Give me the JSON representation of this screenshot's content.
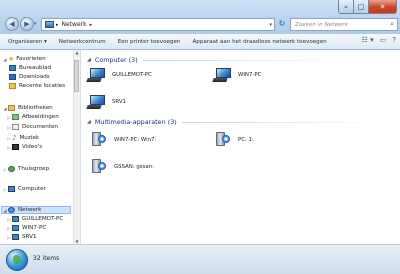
{
  "address": {
    "crumbs": [
      "Netwerk"
    ]
  },
  "search": {
    "placeholder": "Zoeken in Netwerk"
  },
  "toolbar": {
    "organize": "Organiseren",
    "network_center": "Netwerkcentrum",
    "add_printer": "Een printer toevoegen",
    "add_wireless": "Apparaat aan het draadloos netwerk toevoegen"
  },
  "nav": {
    "favorites": "Favorieten",
    "desktop": "Bureaublad",
    "downloads": "Downloads",
    "recent": "Recente locaties",
    "libraries": "Bibliotheken",
    "pictures": "Afbeeldingen",
    "documents": "Documenten",
    "music": "Muziek",
    "videos": "Video's",
    "homegroup": "Thuisgroep",
    "computer": "Computer",
    "network": "Netwerk",
    "net1": "GUILLEMOT-PC",
    "net2": "WIN7-PC",
    "net3": "SRV1"
  },
  "groups": {
    "computer": "Computer (3)",
    "media": "Multimedia-apparaten (3)"
  },
  "computers": [
    "GUILLEMOT-PC",
    "WIN7-PC",
    "SRV1"
  ],
  "media": [
    "WIN7-PC: Win7:",
    "PC: 1:",
    "GSSAN: gssan:"
  ],
  "status": {
    "count": "32 items"
  }
}
